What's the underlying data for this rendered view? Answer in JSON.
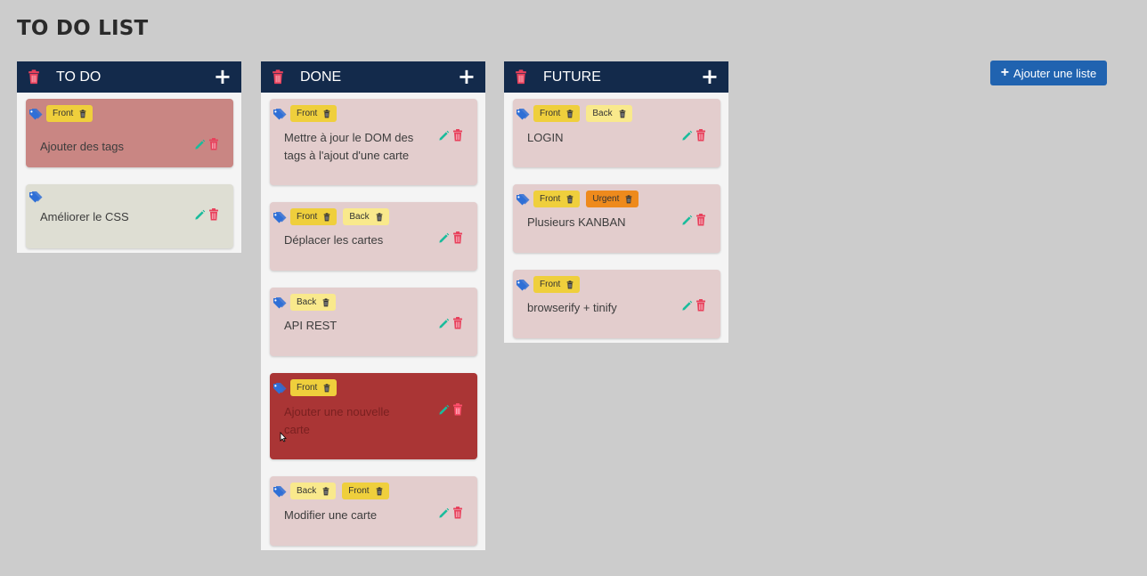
{
  "app": {
    "title": "TO DO LIST",
    "add_list_label": "Ajouter une liste"
  },
  "colors": {
    "header": "#132a4b",
    "trash": "#e8415c",
    "edit": "#1abc9c",
    "tag_icon": "#2f6fd6",
    "button": "#2063b0"
  },
  "lists": [
    {
      "name": "TO DO",
      "cards": [
        {
          "text": "Ajouter des tags",
          "color": "#c98683",
          "tags": [
            {
              "label": "Front",
              "color": "#efcf3c"
            }
          ]
        },
        {
          "text": "Améliorer le CSS",
          "color": "#deded3",
          "tags": []
        }
      ]
    },
    {
      "name": "DONE",
      "cards": [
        {
          "text": "Mettre à jour le DOM des tags à l'ajout d'une carte",
          "color": "#e3cdcd",
          "tags": [
            {
              "label": "Front",
              "color": "#efcf3c"
            }
          ]
        },
        {
          "text": "Déplacer les cartes",
          "color": "#e3cdcd",
          "tags": [
            {
              "label": "Front",
              "color": "#efcf3c"
            },
            {
              "label": "Back",
              "color": "#f9e98c"
            }
          ]
        },
        {
          "text": "API REST",
          "color": "#e3cdcd",
          "tags": [
            {
              "label": "Back",
              "color": "#f9e98c"
            }
          ]
        },
        {
          "text": "Ajouter une nouvelle carte",
          "color": "#aa3535",
          "tags": [
            {
              "label": "Front",
              "color": "#efcf3c"
            }
          ]
        },
        {
          "text": "Modifier une carte",
          "color": "#e3cdcd",
          "tags": [
            {
              "label": "Back",
              "color": "#f9e98c"
            },
            {
              "label": "Front",
              "color": "#efcf3c"
            }
          ]
        }
      ]
    },
    {
      "name": "FUTURE",
      "cards": [
        {
          "text": "LOGIN",
          "color": "#e3cdcd",
          "tags": [
            {
              "label": "Front",
              "color": "#efcf3c"
            },
            {
              "label": "Back",
              "color": "#f9e98c"
            }
          ]
        },
        {
          "text": "Plusieurs KANBAN",
          "color": "#e3cdcd",
          "tags": [
            {
              "label": "Front",
              "color": "#efcf3c"
            },
            {
              "label": "Urgent",
              "color": "#ee8a1c"
            }
          ]
        },
        {
          "text": "browserify + tinify",
          "color": "#e3cdcd",
          "tags": [
            {
              "label": "Front",
              "color": "#efcf3c"
            }
          ]
        }
      ]
    }
  ]
}
